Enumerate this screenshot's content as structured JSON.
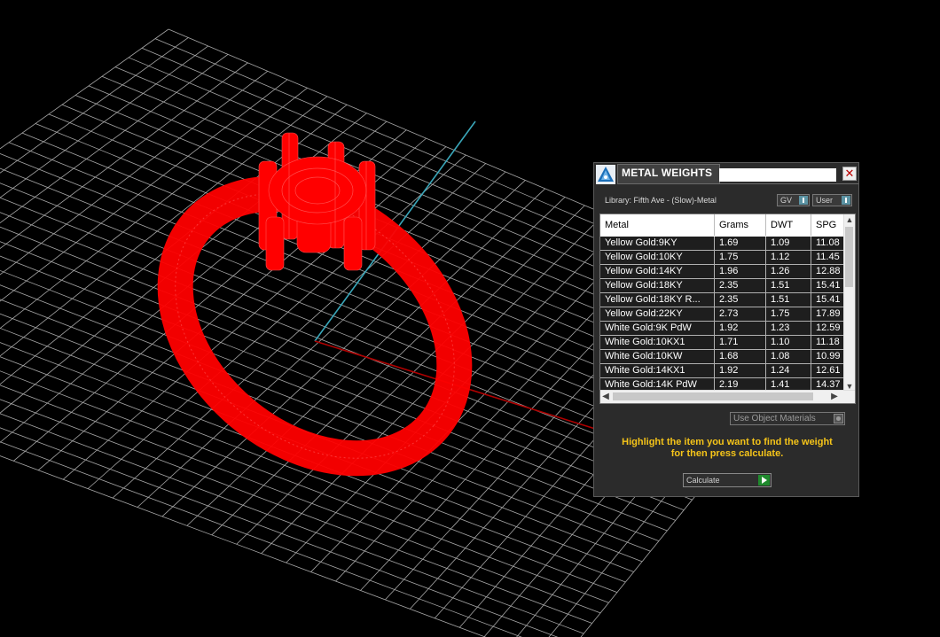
{
  "panel": {
    "title": "METAL WEIGHTS",
    "close_symbol": "✕",
    "library_label": "Library: Fifth Ave - (Slow)-Metal",
    "gv_toggle_label": "GV",
    "user_toggle_label": "User",
    "use_object_materials_label": "Use Object Materials",
    "instructions_line1": "Highlight the item you want to find the weight",
    "instructions_line2": "for then press calculate.",
    "calculate_label": "Calculate",
    "icons": {
      "logo": "matrix-logo-icon",
      "close": "close-icon",
      "calculate": "play-arrow-icon"
    }
  },
  "table": {
    "headers": [
      "Metal",
      "Grams",
      "DWT",
      "SPG"
    ],
    "rows": [
      [
        "Yellow Gold:9KY",
        "1.69",
        "1.09",
        "11.08"
      ],
      [
        "Yellow Gold:10KY",
        "1.75",
        "1.12",
        "11.45"
      ],
      [
        "Yellow Gold:14KY",
        "1.96",
        "1.26",
        "12.88"
      ],
      [
        "Yellow Gold:18KY",
        "2.35",
        "1.51",
        "15.41"
      ],
      [
        "Yellow Gold:18KY R...",
        "2.35",
        "1.51",
        "15.41"
      ],
      [
        "Yellow Gold:22KY",
        "2.73",
        "1.75",
        "17.89"
      ],
      [
        "White Gold:9K PdW",
        "1.92",
        "1.23",
        "12.59"
      ],
      [
        "White Gold:10KX1",
        "1.71",
        "1.10",
        "11.18"
      ],
      [
        "White Gold:10KW",
        "1.68",
        "1.08",
        "10.99"
      ],
      [
        "White Gold:14KX1",
        "1.92",
        "1.24",
        "12.61"
      ],
      [
        "White Gold:14K PdW",
        "2.19",
        "1.41",
        "14.37"
      ]
    ]
  },
  "viewport": {
    "grid_color": "#b9b9b9",
    "model_color": "#ff0000",
    "y_axis_color": "#3aa6b9",
    "x_axis_color": "#b00000"
  }
}
